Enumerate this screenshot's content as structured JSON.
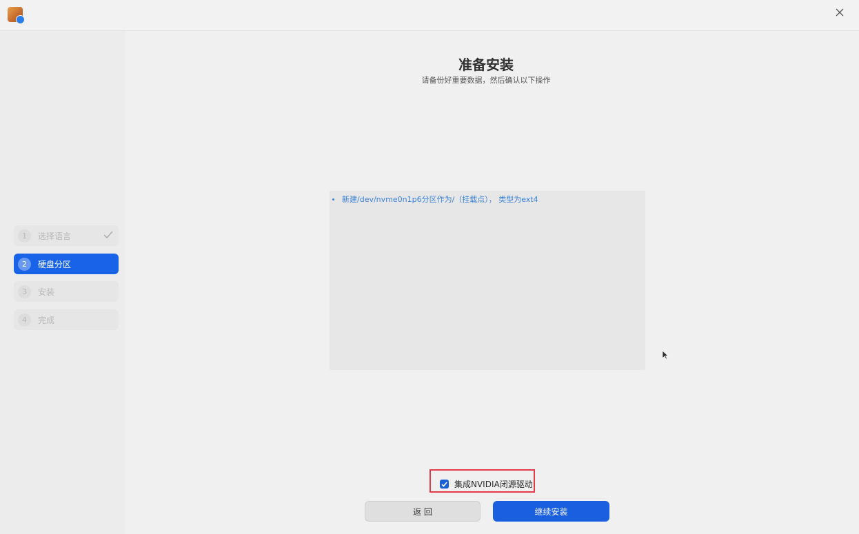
{
  "window": {
    "icon": "installer-app-icon"
  },
  "sidebar": {
    "steps": [
      {
        "number": "1",
        "label": "选择语言",
        "state": "completed"
      },
      {
        "number": "2",
        "label": "硬盘分区",
        "state": "active"
      },
      {
        "number": "3",
        "label": "安装",
        "state": "pending"
      },
      {
        "number": "4",
        "label": "完成",
        "state": "pending"
      }
    ]
  },
  "main": {
    "title": "准备安装",
    "subtitle": "请备份好重要数据，然后确认以下操作",
    "operations": [
      "新建/dev/nvme0n1p6分区作为/（挂载点）， 类型为ext4"
    ]
  },
  "options": {
    "nvidia_driver_label": "集成NVIDIA闭源驱动",
    "nvidia_driver_checked": true
  },
  "buttons": {
    "back_label": "返 回",
    "continue_label": "继续安装"
  },
  "colors": {
    "accent": "#1863e8",
    "highlight_border": "#e23a4b",
    "operation_text": "#3a82d8"
  }
}
